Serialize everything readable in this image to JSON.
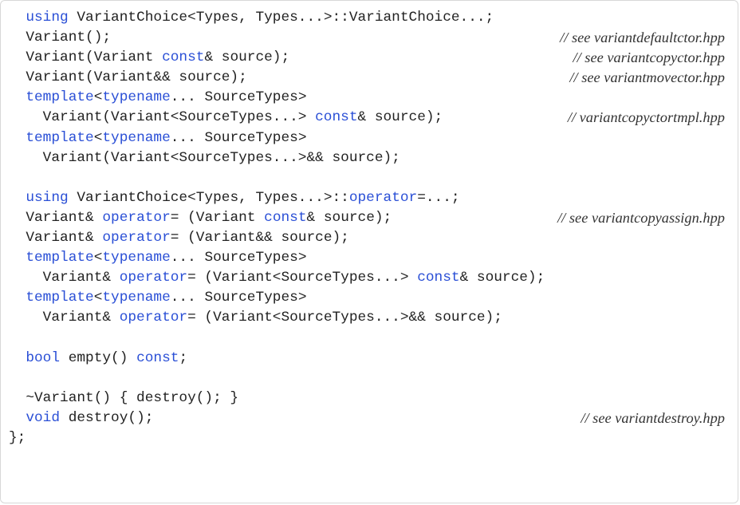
{
  "code": {
    "lines": [
      {
        "tokens": [
          {
            "text": "  "
          },
          {
            "text": "using",
            "kw": true
          },
          {
            "text": " VariantChoice<Types, Types...>::VariantChoice...;"
          }
        ],
        "comment": ""
      },
      {
        "tokens": [
          {
            "text": "  Variant();"
          }
        ],
        "comment": "// see variantdefaultctor.hpp"
      },
      {
        "tokens": [
          {
            "text": "  Variant(Variant "
          },
          {
            "text": "const",
            "kw": true
          },
          {
            "text": "& source);"
          }
        ],
        "comment": "// see variantcopyctor.hpp"
      },
      {
        "tokens": [
          {
            "text": "  Variant(Variant&& source);"
          }
        ],
        "comment": "// see variantmovector.hpp"
      },
      {
        "tokens": [
          {
            "text": "  "
          },
          {
            "text": "template",
            "kw": true
          },
          {
            "text": "<"
          },
          {
            "text": "typename",
            "kw": true
          },
          {
            "text": "... SourceTypes>"
          }
        ],
        "comment": ""
      },
      {
        "tokens": [
          {
            "text": "    Variant(Variant<SourceTypes...> "
          },
          {
            "text": "const",
            "kw": true
          },
          {
            "text": "& source);"
          }
        ],
        "comment": "// variantcopyctortmpl.hpp"
      },
      {
        "tokens": [
          {
            "text": "  "
          },
          {
            "text": "template",
            "kw": true
          },
          {
            "text": "<"
          },
          {
            "text": "typename",
            "kw": true
          },
          {
            "text": "... SourceTypes>"
          }
        ],
        "comment": ""
      },
      {
        "tokens": [
          {
            "text": "    Variant(Variant<SourceTypes...>&& source);"
          }
        ],
        "comment": ""
      },
      {
        "tokens": [],
        "comment": ""
      },
      {
        "tokens": [
          {
            "text": "  "
          },
          {
            "text": "using",
            "kw": true
          },
          {
            "text": " VariantChoice<Types, Types...>::"
          },
          {
            "text": "operator",
            "kw": true
          },
          {
            "text": "=...;"
          }
        ],
        "comment": ""
      },
      {
        "tokens": [
          {
            "text": "  Variant& "
          },
          {
            "text": "operator",
            "kw": true
          },
          {
            "text": "= (Variant "
          },
          {
            "text": "const",
            "kw": true
          },
          {
            "text": "& source);"
          }
        ],
        "comment": "// see variantcopyassign.hpp"
      },
      {
        "tokens": [
          {
            "text": "  Variant& "
          },
          {
            "text": "operator",
            "kw": true
          },
          {
            "text": "= (Variant&& source);"
          }
        ],
        "comment": ""
      },
      {
        "tokens": [
          {
            "text": "  "
          },
          {
            "text": "template",
            "kw": true
          },
          {
            "text": "<"
          },
          {
            "text": "typename",
            "kw": true
          },
          {
            "text": "... SourceTypes>"
          }
        ],
        "comment": ""
      },
      {
        "tokens": [
          {
            "text": "    Variant& "
          },
          {
            "text": "operator",
            "kw": true
          },
          {
            "text": "= (Variant<SourceTypes...> "
          },
          {
            "text": "const",
            "kw": true
          },
          {
            "text": "& source);"
          }
        ],
        "comment": ""
      },
      {
        "tokens": [
          {
            "text": "  "
          },
          {
            "text": "template",
            "kw": true
          },
          {
            "text": "<"
          },
          {
            "text": "typename",
            "kw": true
          },
          {
            "text": "... SourceTypes>"
          }
        ],
        "comment": ""
      },
      {
        "tokens": [
          {
            "text": "    Variant& "
          },
          {
            "text": "operator",
            "kw": true
          },
          {
            "text": "= (Variant<SourceTypes...>&& source);"
          }
        ],
        "comment": ""
      },
      {
        "tokens": [],
        "comment": ""
      },
      {
        "tokens": [
          {
            "text": "  "
          },
          {
            "text": "bool",
            "kw": true
          },
          {
            "text": " empty() "
          },
          {
            "text": "const",
            "kw": true
          },
          {
            "text": ";"
          }
        ],
        "comment": ""
      },
      {
        "tokens": [],
        "comment": ""
      },
      {
        "tokens": [
          {
            "text": "  ~Variant() { destroy(); }"
          }
        ],
        "comment": ""
      },
      {
        "tokens": [
          {
            "text": "  "
          },
          {
            "text": "void",
            "kw": true
          },
          {
            "text": " destroy();"
          }
        ],
        "comment": "// see variantdestroy.hpp"
      },
      {
        "tokens": [
          {
            "text": "};"
          }
        ],
        "comment": ""
      }
    ]
  }
}
